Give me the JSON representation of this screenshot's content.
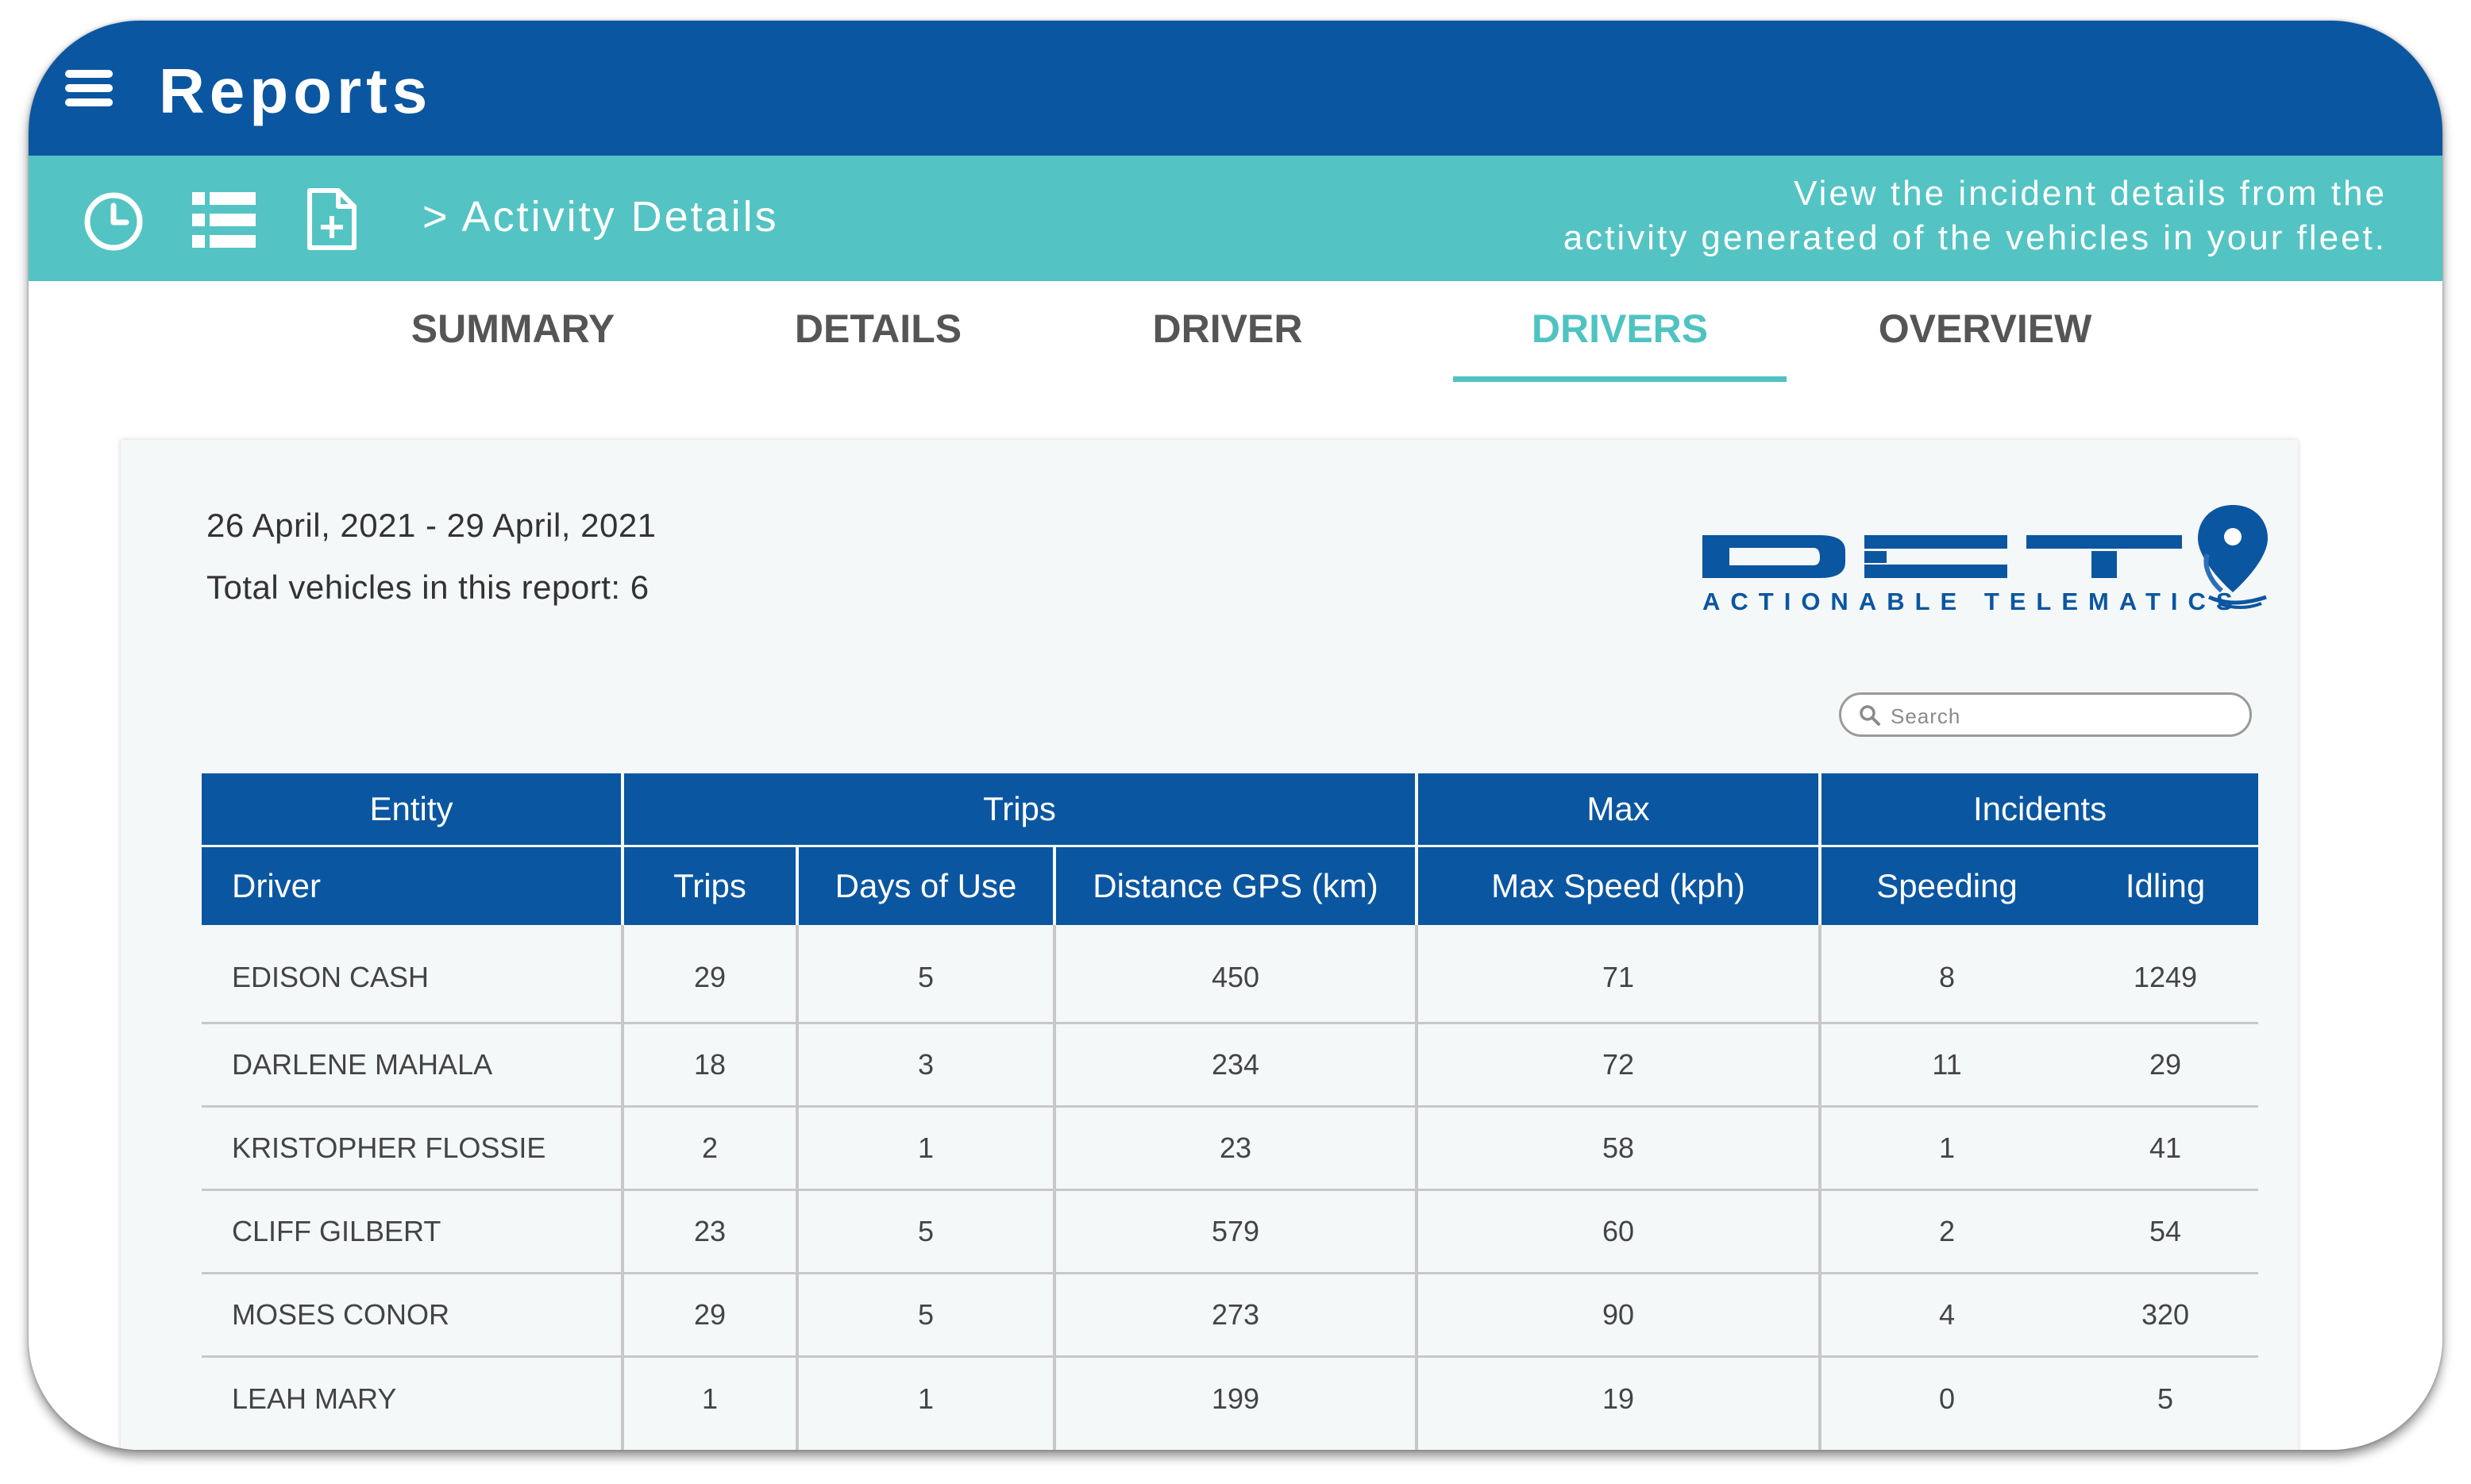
{
  "app": {
    "title": "Reports"
  },
  "toolbar": {
    "icons": [
      "clock-icon",
      "list-icon",
      "new-document-icon"
    ],
    "breadcrumb": "> Activity Details",
    "help_line1": "View the incident details from the",
    "help_line2": "activity generated of the vehicles in your fleet."
  },
  "tabs": [
    {
      "label": "SUMMARY",
      "active": false
    },
    {
      "label": "DETAILS",
      "active": false
    },
    {
      "label": "DRIVER",
      "active": false
    },
    {
      "label": "DRIVERS",
      "active": true
    },
    {
      "label": "OVERVIEW",
      "active": false
    }
  ],
  "report": {
    "date_range": "26 April, 2021 - 29 April, 2021",
    "total_vehicles": "Total vehicles in this report: 6",
    "logo_tagline": "ACTIONABLE TELEMATICS",
    "search_placeholder": "Search"
  },
  "table": {
    "groups": [
      "Entity",
      "Trips",
      "Max",
      "Incidents"
    ],
    "columns": [
      "Driver",
      "Trips",
      "Days of Use",
      "Distance GPS (km)",
      "Max Speed (kph)",
      "Speeding",
      "Idling"
    ],
    "rows": [
      [
        "EDISON CASH",
        "29",
        "5",
        "450",
        "71",
        "8",
        "1249"
      ],
      [
        "DARLENE MAHALA",
        "18",
        "3",
        "234",
        "72",
        "11",
        "29"
      ],
      [
        "KRISTOPHER FLOSSIE",
        "2",
        "1",
        "23",
        "58",
        "1",
        "41"
      ],
      [
        "CLIFF GILBERT",
        "23",
        "5",
        "579",
        "60",
        "2",
        "54"
      ],
      [
        "MOSES CONOR",
        "29",
        "5",
        "273",
        "90",
        "4",
        "320"
      ],
      [
        "LEAH MARY",
        "1",
        "1",
        "199",
        "19",
        "0",
        "5"
      ]
    ]
  },
  "colors": {
    "primary": "#0b56a0",
    "accent": "#53c4c3",
    "active_tab": "#4fc3c1"
  }
}
